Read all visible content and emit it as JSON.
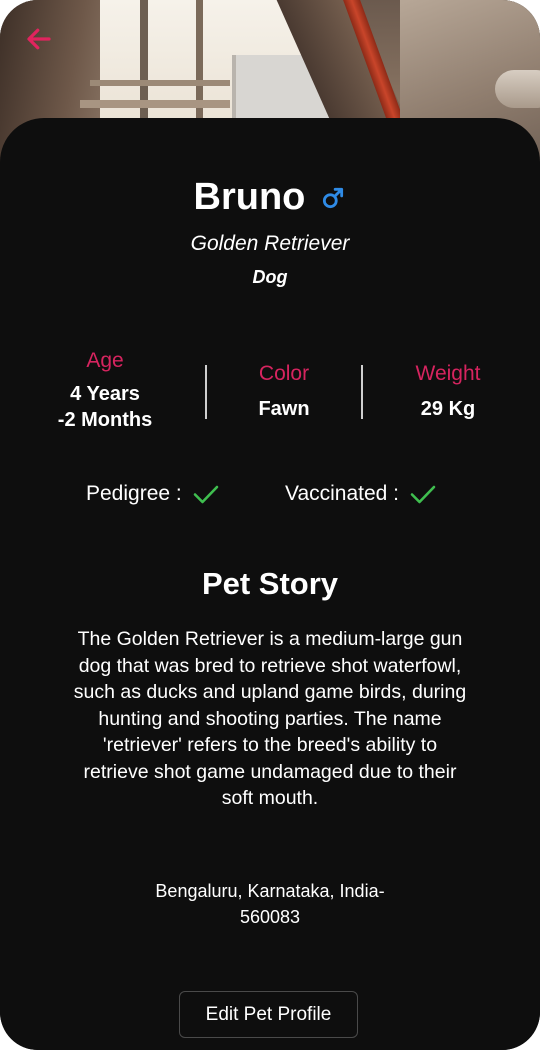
{
  "header": {
    "back_icon": "arrow-left-icon",
    "accent_color": "#e0245e"
  },
  "pet": {
    "name": "Bruno",
    "gender_icon": "male-symbol-icon",
    "gender_color": "#2f8be6",
    "breed": "Golden Retriever",
    "species": "Dog"
  },
  "stats": {
    "age_label": "Age",
    "age_value": "4 Years\n-2 Months",
    "color_label": "Color",
    "color_value": "Fawn",
    "weight_label": "Weight",
    "weight_value": "29 Kg",
    "label_color": "#d6245f"
  },
  "checks": {
    "pedigree_label": "Pedigree :",
    "vaccinated_label": "Vaccinated :",
    "check_icon": "checkmark-icon",
    "check_color": "#3fbe4f"
  },
  "story": {
    "title": "Pet Story",
    "text": "The Golden Retriever is a medium-large gun dog that was bred to retrieve shot waterfowl, such as ducks and upland game birds, during hunting and shooting parties. The name 'retriever' refers to the breed's ability to retrieve shot game undamaged due to their soft mouth."
  },
  "location": {
    "address": "Bengaluru, Karnataka, India-560083"
  },
  "actions": {
    "edit_label": "Edit Pet Profile"
  }
}
